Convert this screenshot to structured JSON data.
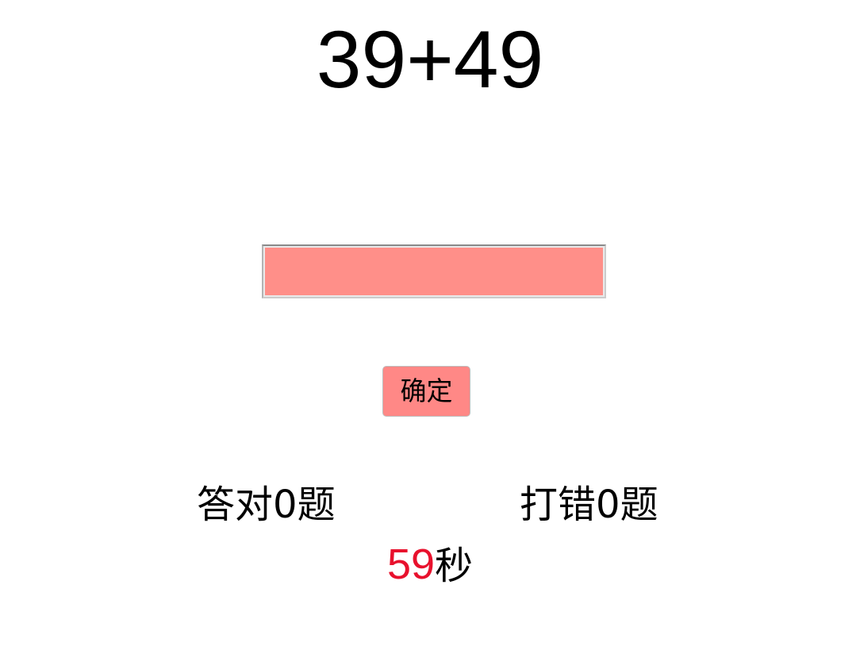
{
  "question": {
    "text": "39+49"
  },
  "answer_input": {
    "value": "",
    "placeholder": "",
    "background_color": "#ff8f89"
  },
  "confirm_button": {
    "label": "确定",
    "background_color": "#ff8886"
  },
  "stats": {
    "correct_prefix": "答对",
    "correct_count": "0",
    "correct_suffix": "题",
    "wrong_prefix": "打错",
    "wrong_count": "0",
    "wrong_suffix": "题"
  },
  "timer": {
    "seconds": "59",
    "unit": "秒",
    "seconds_color": "#e8112d"
  }
}
